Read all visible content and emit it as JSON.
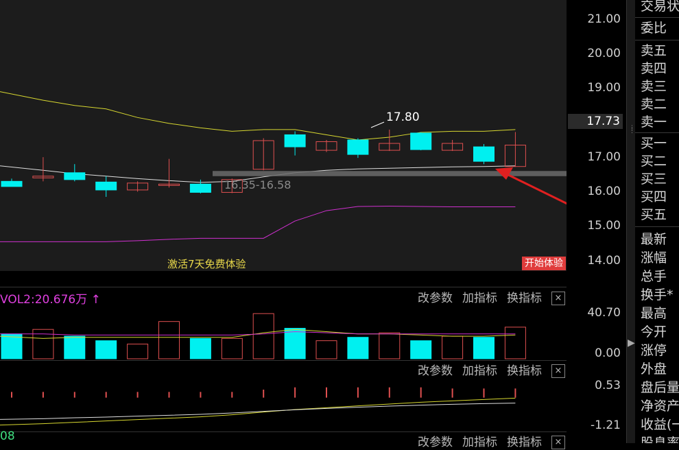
{
  "price_axis": {
    "labels": [
      "21.00",
      "20.00",
      "19.00",
      "17.00",
      "16.00",
      "15.00",
      "14.00"
    ],
    "current": "17.73",
    "vol_labels": [
      "40.70",
      "0.00"
    ],
    "ind_labels": [
      "0.53",
      "-1.21"
    ]
  },
  "quote_panel": {
    "top_items": [
      "交易状",
      "委比"
    ],
    "sell_items": [
      "卖五",
      "卖四",
      "卖三",
      "卖二",
      "卖一"
    ],
    "buy_items": [
      "买一",
      "买二",
      "买三",
      "买四",
      "买五"
    ],
    "stat_items": [
      "最新",
      "涨幅",
      "总手",
      "换手*",
      "最高",
      "今开",
      "涨停",
      "外盘",
      "盘后量",
      "净资产",
      "收益(一",
      "股息率"
    ]
  },
  "main_chart": {
    "high_marker": "17.80",
    "range_label": "16.35-16.58",
    "promo_text": "激活7天免费体验",
    "promo_button": "开始体验"
  },
  "vol_panel": {
    "label": "VOL2:20.676万",
    "arrow": "↑",
    "toolbar": [
      "改参数",
      "加指标",
      "换指标"
    ],
    "close": "×"
  },
  "ind_panel": {
    "toolbar": [
      "改参数",
      "加指标",
      "换指标"
    ],
    "close": "×"
  },
  "bottom_panel": {
    "label": "08",
    "toolbar": [
      "改参数",
      "加指标",
      "换指标"
    ],
    "close": "×"
  },
  "colors": {
    "up": "#e05050",
    "down": "#00f0f0",
    "ma_yellow": "#d8d830",
    "ma_white": "#e0e0e0",
    "ma_magenta": "#d030d0",
    "support_band": "#6a6a6a",
    "arrow": "#e02020"
  },
  "chart_data": {
    "type": "candlestick",
    "candles": [
      {
        "o": 16.3,
        "h": 16.38,
        "l": 16.15,
        "c": 16.15
      },
      {
        "o": 16.4,
        "h": 17.0,
        "l": 16.3,
        "c": 16.45
      },
      {
        "o": 16.55,
        "h": 16.8,
        "l": 16.3,
        "c": 16.35
      },
      {
        "o": 16.28,
        "h": 16.45,
        "l": 15.85,
        "c": 16.05
      },
      {
        "o": 16.05,
        "h": 16.3,
        "l": 16.0,
        "c": 16.25
      },
      {
        "o": 16.18,
        "h": 16.95,
        "l": 16.12,
        "c": 16.22
      },
      {
        "o": 16.22,
        "h": 16.35,
        "l": 15.95,
        "c": 15.98
      },
      {
        "o": 15.98,
        "h": 16.38,
        "l": 15.96,
        "c": 16.35
      },
      {
        "o": 16.65,
        "h": 17.55,
        "l": 16.62,
        "c": 17.48
      },
      {
        "o": 17.65,
        "h": 17.75,
        "l": 17.05,
        "c": 17.3
      },
      {
        "o": 17.2,
        "h": 17.5,
        "l": 17.15,
        "c": 17.45
      },
      {
        "o": 17.5,
        "h": 17.55,
        "l": 16.98,
        "c": 17.08
      },
      {
        "o": 17.2,
        "h": 17.8,
        "l": 17.18,
        "c": 17.4
      },
      {
        "o": 17.7,
        "h": 17.72,
        "l": 17.2,
        "c": 17.22
      },
      {
        "o": 17.2,
        "h": 17.5,
        "l": 17.18,
        "c": 17.4
      },
      {
        "o": 17.3,
        "h": 17.38,
        "l": 16.8,
        "c": 16.88
      },
      {
        "o": 16.73,
        "h": 17.73,
        "l": 16.72,
        "c": 17.35
      }
    ],
    "ma_yellow": [
      18.9,
      18.65,
      18.5,
      18.4,
      18.15,
      17.98,
      17.85,
      17.75,
      17.8,
      17.8,
      17.65,
      17.5,
      17.58,
      17.72,
      17.75,
      17.75,
      17.8
    ],
    "ma_white": [
      16.75,
      16.62,
      16.52,
      16.45,
      16.38,
      16.32,
      16.27,
      16.3,
      16.43,
      16.55,
      16.62,
      16.66,
      16.68,
      16.7,
      16.72,
      16.73,
      16.75
    ],
    "ma_magenta": [
      14.55,
      14.55,
      14.55,
      14.55,
      14.58,
      14.62,
      14.65,
      14.65,
      14.65,
      15.15,
      15.45,
      15.57,
      15.58,
      15.57,
      15.56,
      15.56,
      15.56
    ],
    "support_band": [
      16.45,
      16.6
    ],
    "ylim": [
      13.7,
      21.5
    ],
    "volume": {
      "values": [
        22,
        26,
        20,
        16,
        13,
        33,
        18,
        18,
        40,
        27,
        16,
        19,
        23,
        16,
        20,
        19,
        28
      ],
      "ma_yellow": [
        20,
        18,
        19,
        19,
        19,
        19,
        19,
        19,
        23,
        26,
        24,
        22,
        22,
        21,
        20,
        20,
        21
      ],
      "ma_magenta": [
        22,
        22,
        21,
        21,
        21,
        21,
        21,
        21,
        22,
        24,
        23,
        22,
        22,
        22,
        22,
        22,
        22
      ],
      "ylim": [
        0,
        40.7
      ]
    },
    "indicator": {
      "bars": [
        0.25,
        0.25,
        0.25,
        0.25,
        0.25,
        0.25,
        0.25,
        0.25,
        0.35,
        0.45,
        0.45,
        0.45,
        0.45,
        0.45,
        0.4,
        0.4,
        0.4
      ],
      "line_yellow": [
        -1.2,
        -1.14,
        -1.08,
        -1.02,
        -0.96,
        -0.9,
        -0.84,
        -0.75,
        -0.63,
        -0.52,
        -0.44,
        -0.36,
        -0.28,
        -0.2,
        -0.14,
        -0.08,
        -0.02
      ],
      "line_white": [
        -0.95,
        -0.92,
        -0.88,
        -0.85,
        -0.81,
        -0.77,
        -0.73,
        -0.67,
        -0.6,
        -0.53,
        -0.47,
        -0.42,
        -0.37,
        -0.33,
        -0.29,
        -0.26,
        -0.24
      ],
      "ylim": [
        -1.25,
        0.55
      ]
    }
  }
}
